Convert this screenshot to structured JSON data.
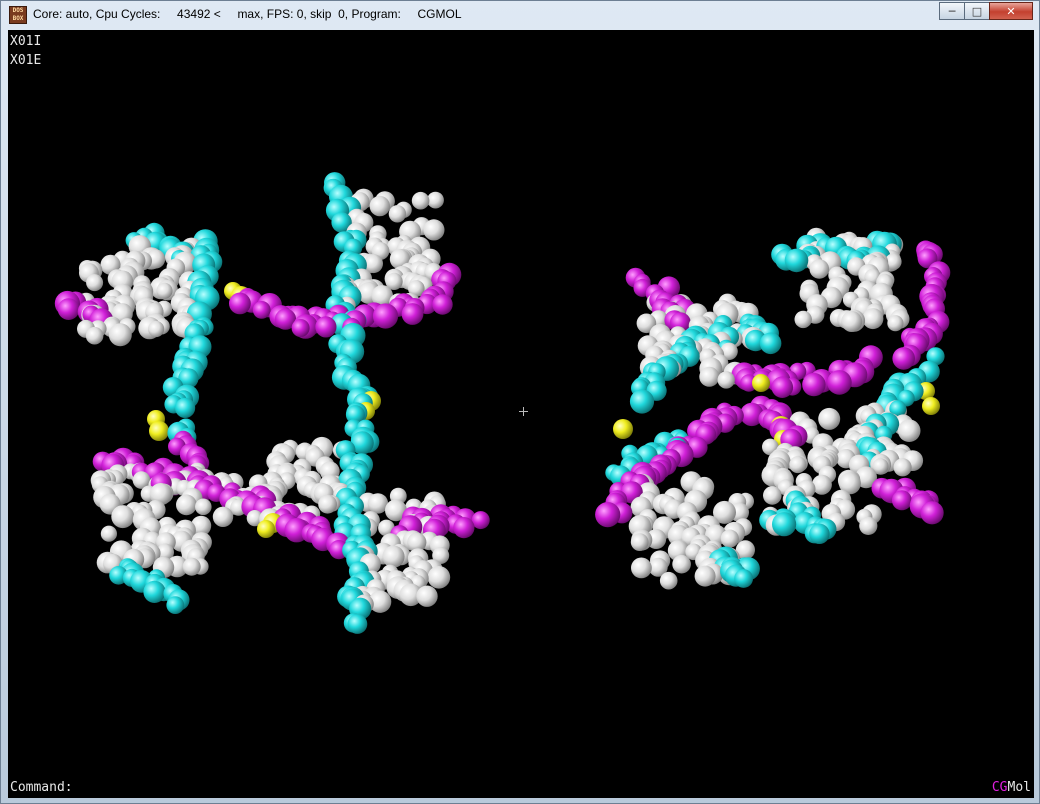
{
  "window": {
    "title": "Core: auto, Cpu Cycles:     43492 <     max, FPS: 0, skip  0, Program:     CGMOL",
    "icon_label_top": "DOS",
    "icon_label_bottom": "BOX"
  },
  "viewport": {
    "molecule_labels": [
      "X01I",
      "X01E"
    ],
    "command_prompt": "Command:",
    "brand_part1": "CG",
    "brand_part2": "Mol",
    "atom_colors": {
      "cyan": "#20d8dc",
      "white": "#e6e6e6",
      "magenta": "#d020d8",
      "yellow": "#f0ee20"
    }
  }
}
